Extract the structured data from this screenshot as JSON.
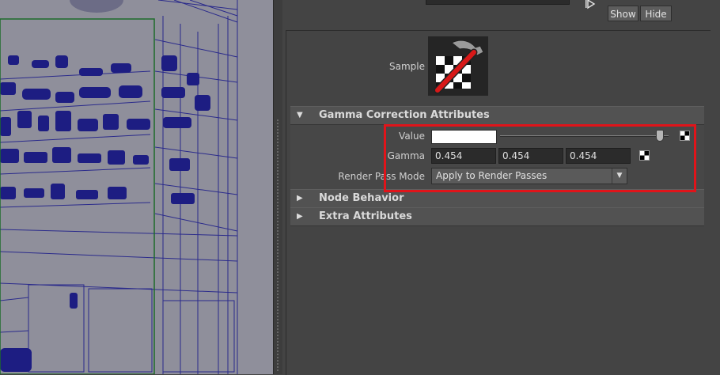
{
  "toolbar": {
    "show_label": "Show",
    "hide_label": "Hide"
  },
  "sample": {
    "label": "Sample"
  },
  "gamma_section": {
    "title": "Gamma Correction Attributes",
    "value_label": "Value",
    "value_color": "#ffffff",
    "value_slider_fraction": 0.95,
    "gamma_label": "Gamma",
    "gamma_values": [
      "0.454",
      "0.454",
      "0.454"
    ],
    "render_pass_label": "Render Pass Mode",
    "render_pass_value": "Apply to Render Passes"
  },
  "sections": {
    "node_behavior": "Node Behavior",
    "extra_attributes": "Extra Attributes"
  },
  "colors": {
    "highlight": "#e0141a",
    "viewport_bg": "#8f8f9b",
    "wireframe": "#1a1a7a",
    "camera_frame": "#1d6b2a"
  },
  "icons": {
    "section_expanded": "triangle-down-icon",
    "section_collapsed": "triangle-right-icon",
    "map_button": "checker-map-icon",
    "node_swatch": "gamma-node-icon"
  }
}
